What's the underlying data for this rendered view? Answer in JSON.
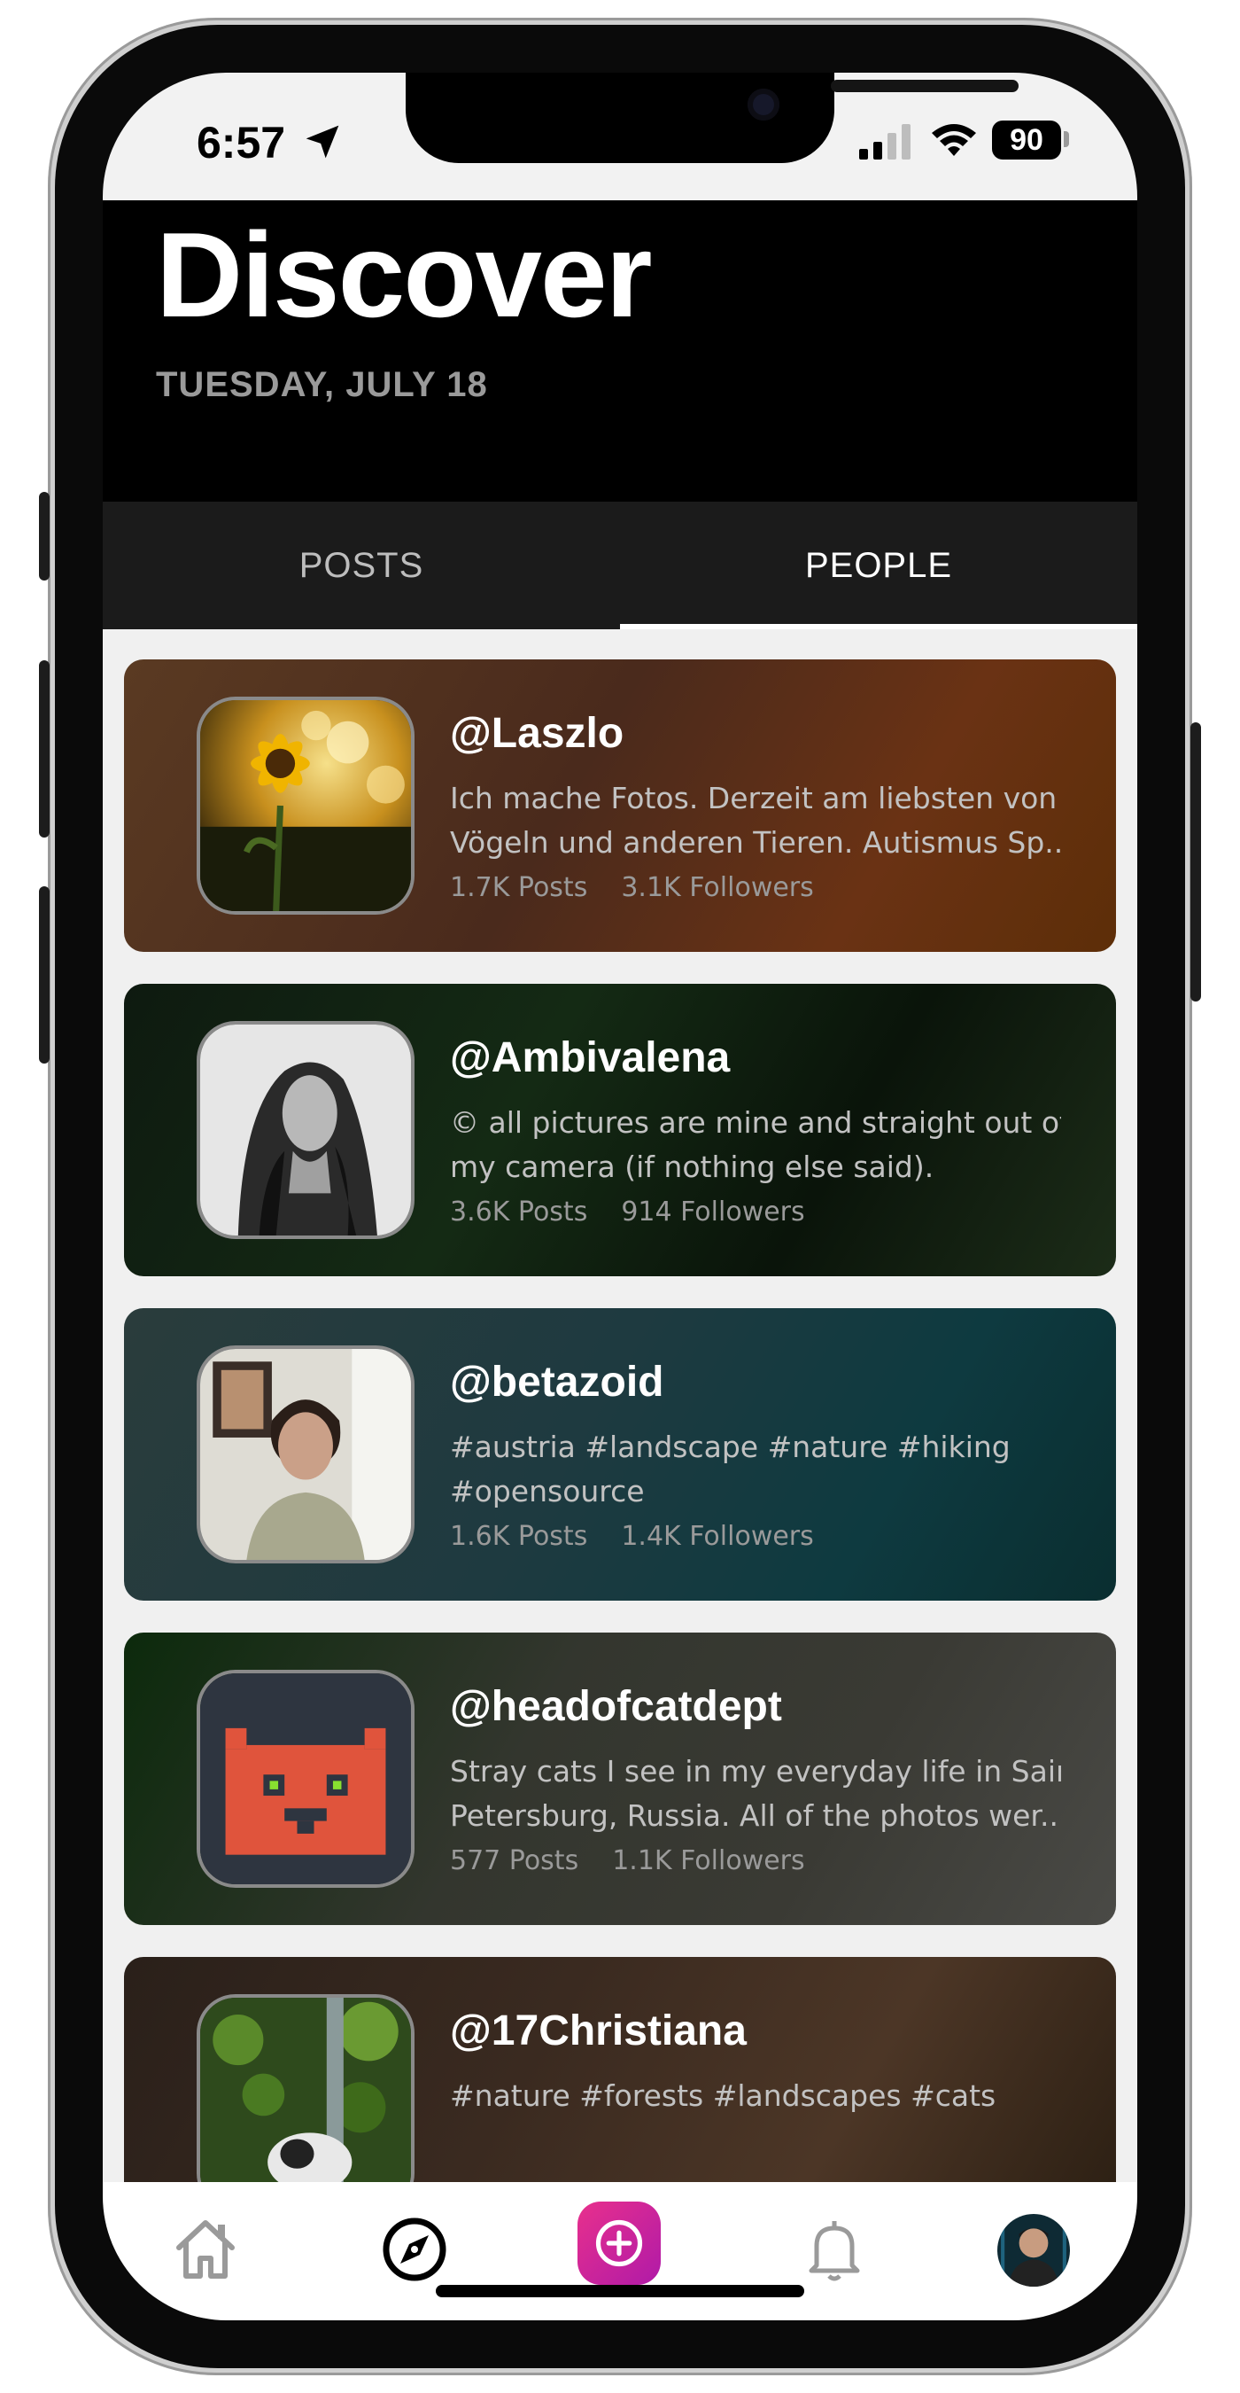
{
  "status_bar": {
    "time": "6:57",
    "battery": "90"
  },
  "header": {
    "title": "Discover",
    "date": "TUESDAY, JULY 18"
  },
  "tabs": [
    {
      "label": "POSTS",
      "selected": false
    },
    {
      "label": "PEOPLE",
      "selected": true
    }
  ],
  "people": [
    {
      "handle": "@Laszlo",
      "bio_lines": [
        "Ich mache Fotos. Derzeit am liebsten von",
        "Vögeln und anderen Tieren. Autismus Sp..."
      ],
      "posts": "1.7K Posts",
      "followers": "3.1K Followers",
      "avatar": "sunflower-photo"
    },
    {
      "handle": "@Ambivalena",
      "bio_lines": [
        "© all pictures are mine and straight out of",
        "my camera (if nothing else said)."
      ],
      "posts": "3.6K Posts",
      "followers": "914 Followers",
      "avatar": "bw-portrait-photo"
    },
    {
      "handle": "@betazoid",
      "bio_lines": [
        "#austria #landscape #nature #hiking",
        "#opensource"
      ],
      "posts": "1.6K Posts",
      "followers": "1.4K Followers",
      "avatar": "woman-portrait-photo"
    },
    {
      "handle": "@headofcatdept",
      "bio_lines": [
        "Stray cats I see in my everyday life in Saint",
        "Petersburg, Russia. All of the photos wer..."
      ],
      "posts": "577 Posts",
      "followers": "1.1K Followers",
      "avatar": "pixel-cat-icon"
    },
    {
      "handle": "@17Christiana",
      "bio_lines": [
        "#nature #forests #landscapes #cats",
        ""
      ],
      "posts": "",
      "followers": "",
      "avatar": "cat-in-leaves-photo"
    }
  ],
  "bottom_nav": [
    {
      "name": "home",
      "icon": "house-icon",
      "active": false
    },
    {
      "name": "discover",
      "icon": "compass-icon",
      "active": true
    },
    {
      "name": "create",
      "icon": "plus-circle-icon",
      "active": false
    },
    {
      "name": "notifications",
      "icon": "bell-icon",
      "active": false
    },
    {
      "name": "profile",
      "icon": "avatar",
      "active": false
    }
  ],
  "colors": {
    "create_gradient_start": "#e8308c",
    "create_gradient_end": "#b01aa8",
    "header_bg": "#000000",
    "tab_bar_bg": "#1b1b1b"
  }
}
